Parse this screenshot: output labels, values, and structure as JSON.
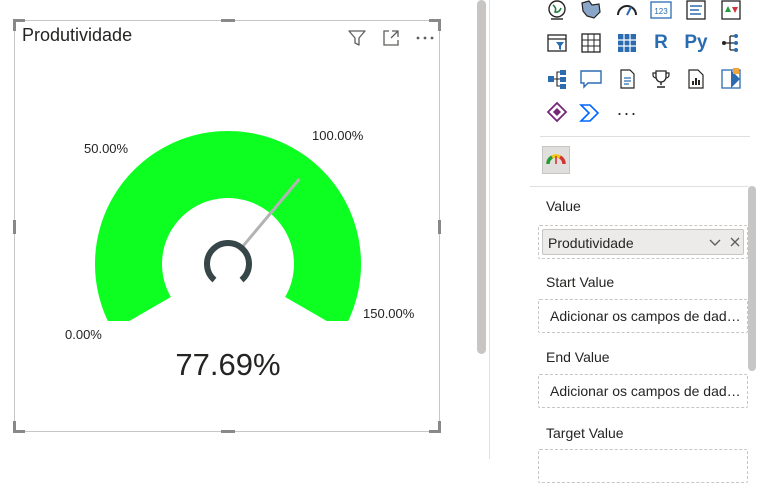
{
  "visual": {
    "title": "Produtividade",
    "header_icons": [
      "filter-icon",
      "focus-mode-icon",
      "more-options-icon"
    ],
    "gauge": {
      "min_label": "0.00%",
      "mid_label": "50.00%",
      "upper_label": "100.00%",
      "max_label": "150.00%",
      "value_label": "77.69%",
      "min": 0,
      "max": 1.5,
      "target": 1.0,
      "value": 0.7769,
      "fill_color": "#0dff22",
      "needle_color": "#b3b3b3",
      "hub_color": "#374649"
    }
  },
  "viz_pane": {
    "icon_rows": [
      [
        "globe-map-icon",
        "filled-map-icon",
        "gauge-icon",
        "card-icon",
        "multi-row-card-icon",
        "kpi-icon"
      ],
      [
        "slicer-icon",
        "table-icon",
        "matrix-icon",
        "r-visual-icon",
        "python-visual-icon",
        "key-influencers-icon"
      ],
      [
        "decomposition-tree-icon",
        "qa-icon",
        "smart-narrative-icon",
        "goals-icon",
        "paginated-report-icon",
        "power-apps-icon"
      ],
      [
        "power-automate-icon",
        "power-automate-chevron-icon",
        "more-visuals-icon"
      ]
    ],
    "r_label": "R",
    "py_label": "Py",
    "card_label": "123",
    "more_label": "···",
    "custom_visual_icon": "custom-gauge-visual-icon",
    "wells": [
      {
        "title": "Value",
        "field": "Produtividade",
        "placeholder": ""
      },
      {
        "title": "Start Value",
        "field": "",
        "placeholder": "Adicionar os campos de dados aqui"
      },
      {
        "title": "End Value",
        "field": "",
        "placeholder": "Adicionar os campos de dados aqui"
      },
      {
        "title": "Target Value",
        "field": "",
        "placeholder": ""
      }
    ]
  }
}
